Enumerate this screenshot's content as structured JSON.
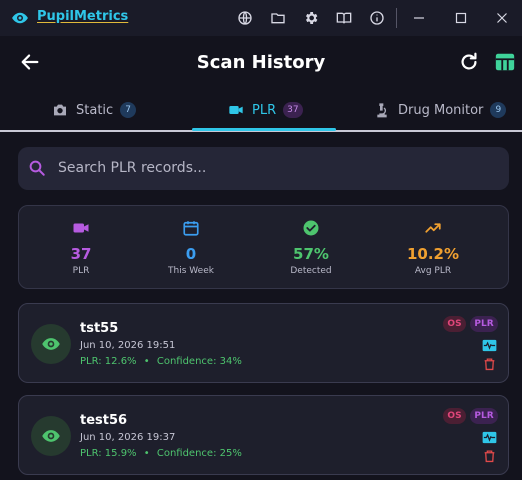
{
  "app": {
    "name": "PupilMetrics"
  },
  "header": {
    "title": "Scan History"
  },
  "tabs": [
    {
      "label": "Static",
      "count": "7",
      "active": false
    },
    {
      "label": "PLR",
      "count": "37",
      "active": true
    },
    {
      "label": "Drug Monitor",
      "count": "9",
      "active": false
    }
  ],
  "search": {
    "placeholder": "Search PLR records...",
    "value": ""
  },
  "stats": [
    {
      "value": "37",
      "label": "PLR",
      "color": "#b65be0",
      "icon": "video-icon"
    },
    {
      "value": "0",
      "label": "This Week",
      "color": "#3b9df0",
      "icon": "calendar-icon"
    },
    {
      "value": "57%",
      "label": "Detected",
      "color": "#4ec46e",
      "icon": "check-circle-icon"
    },
    {
      "value": "10.2%",
      "label": "Avg PLR",
      "color": "#f0a030",
      "icon": "trending-up-icon"
    }
  ],
  "records": [
    {
      "name": "tst55",
      "datetime": "Jun 10, 2026 19:51",
      "plr": "PLR: 12.6%",
      "separator": "•",
      "confidence": "Confidence: 34%",
      "tags": [
        "OS",
        "PLR"
      ]
    },
    {
      "name": "test56",
      "datetime": "Jun 10, 2026 19:37",
      "plr": "PLR: 15.9%",
      "separator": "•",
      "confidence": "Confidence: 25%",
      "tags": [
        "OS",
        "PLR"
      ]
    }
  ],
  "colors": {
    "accent": "#2fc6e8",
    "background": "#13131d",
    "card": "#1e1f2c",
    "danger": "#e24a4a",
    "success": "#4ec46e"
  }
}
